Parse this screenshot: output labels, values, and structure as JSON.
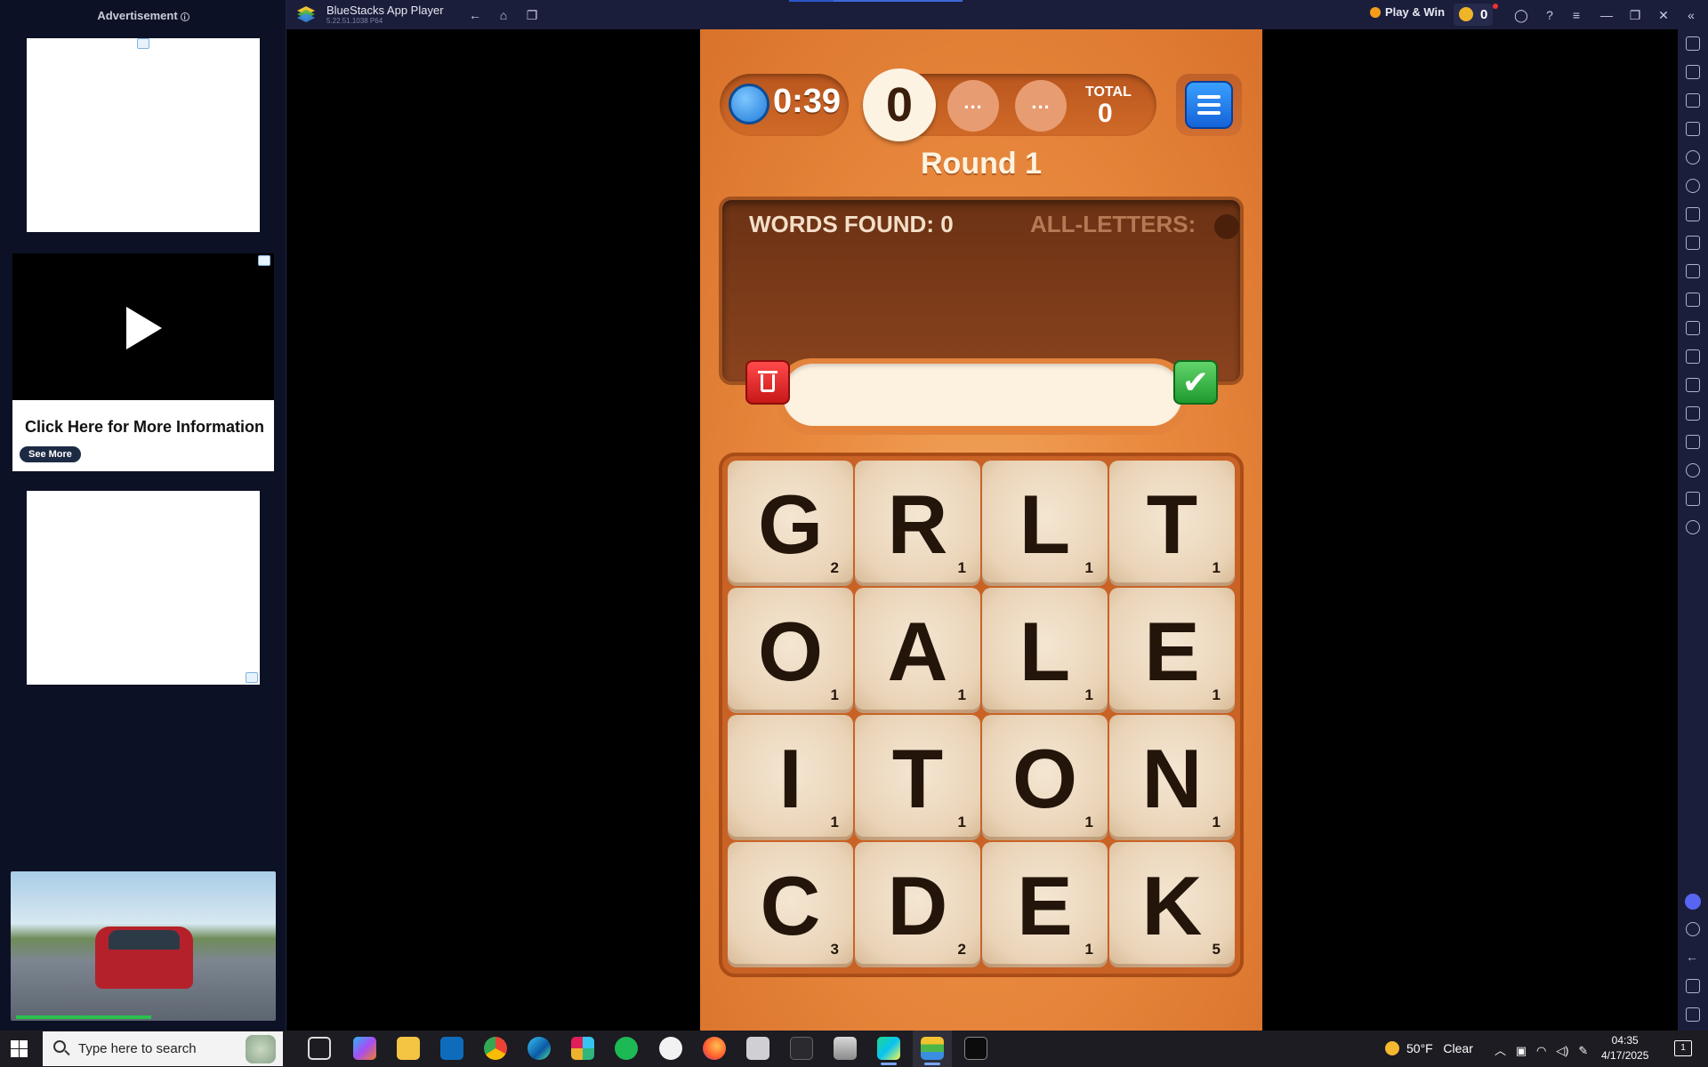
{
  "ad_sidebar": {
    "header": "Advertisement",
    "info_icon": "info-icon",
    "video_ad": {
      "headline": "Click Here for More Information",
      "cta": "See More"
    }
  },
  "titlebar": {
    "app_name": "BlueStacks App Player",
    "version": "5.22.51.1038  P64",
    "play_win": "Play & Win",
    "coins": "0"
  },
  "game": {
    "timer": "0:39",
    "current_score": "0",
    "pending_1": "...",
    "pending_2": "...",
    "total_label": "TOTAL",
    "total_value": "0",
    "round": "Round 1",
    "words_found": "WORDS FOUND: 0",
    "all_letters": "ALL-LETTERS:",
    "submit_icon": "✔",
    "board": [
      {
        "letter": "G",
        "points": "2"
      },
      {
        "letter": "R",
        "points": "1"
      },
      {
        "letter": "L",
        "points": "1"
      },
      {
        "letter": "T",
        "points": "1"
      },
      {
        "letter": "O",
        "points": "1"
      },
      {
        "letter": "A",
        "points": "1"
      },
      {
        "letter": "L",
        "points": "1"
      },
      {
        "letter": "E",
        "points": "1"
      },
      {
        "letter": "I",
        "points": "1"
      },
      {
        "letter": "T",
        "points": "1"
      },
      {
        "letter": "O",
        "points": "1"
      },
      {
        "letter": "N",
        "points": "1"
      },
      {
        "letter": "C",
        "points": "3"
      },
      {
        "letter": "D",
        "points": "2"
      },
      {
        "letter": "E",
        "points": "1"
      },
      {
        "letter": "K",
        "points": "5"
      }
    ]
  },
  "taskbar": {
    "search_placeholder": "Type here to search",
    "weather_temp": "50°F",
    "weather_desc": "Clear",
    "time": "04:35",
    "date": "4/17/2025",
    "notification_count": "1",
    "apps": [
      "task-view",
      "copilot",
      "file-explorer",
      "outlook",
      "chrome",
      "edge",
      "slack",
      "spotify",
      "media-player",
      "firefox",
      "files",
      "cursor",
      "archive",
      "pycharm",
      "bluestacks",
      "terminal"
    ]
  },
  "colors": {
    "game_bg": "#e98a3f",
    "titlebar_bg": "#1b1e3a",
    "accent": "#3b6ad9"
  }
}
